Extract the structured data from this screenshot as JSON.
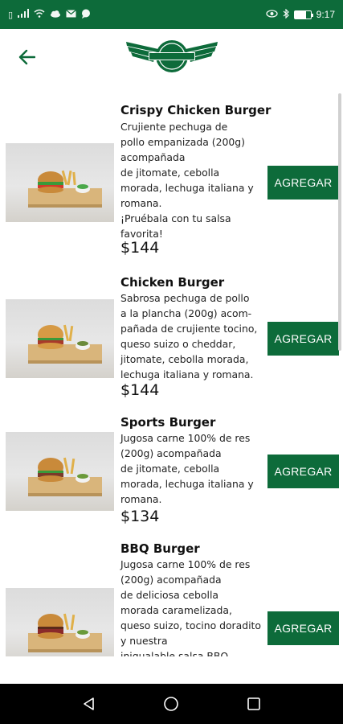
{
  "status_bar": {
    "left_icons": [
      "sim-icon",
      "signal-icon",
      "wifi-icon",
      "cloud-icon",
      "mail-icon",
      "chat-icon"
    ],
    "right_icons": [
      "eye-icon",
      "bluetooth-icon",
      "battery-icon"
    ],
    "time": "9:17"
  },
  "header": {
    "back_icon": "arrow-left-icon",
    "logo_alt": "WINGSTOP"
  },
  "colors": {
    "brand_green": "#0d6b3a",
    "text": "#111111"
  },
  "menu": {
    "add_label": "AGREGAR",
    "items": [
      {
        "name": "Crispy Chicken Burger",
        "description": "Crujiente pechuga de\npollo empanizada (200g)\nacompañada\nde jitomate, cebolla\nmorada, lechuga italiana y\nromana.\n¡Pruébala con tu salsa\nfavorita!",
        "price": "$144"
      },
      {
        "name": "Chicken Burger",
        "description": "Sabrosa pechuga de pollo\na la plancha (200g) acom-\npañada de crujiente tocino,\nqueso suizo o cheddar,\njitomate, cebolla morada,\nlechuga italiana y romana.",
        "price": "$144"
      },
      {
        "name": "Sports Burger",
        "description": "Jugosa carne 100% de res\n(200g) acompañada\nde jitomate, cebolla\nmorada, lechuga italiana y\nromana.",
        "price": "$134"
      },
      {
        "name": "BBQ Burger",
        "description": "Jugosa carne 100% de res\n(200g) acompañada\nde deliciosa cebolla\nmorada caramelizada,\nqueso suizo, tocino doradito\ny nuestra\ninigualable salsa BBQ",
        "price": ""
      }
    ]
  },
  "nav": {
    "back_icon": "nav-back-icon",
    "home_icon": "nav-home-icon",
    "recents_icon": "nav-recents-icon"
  }
}
